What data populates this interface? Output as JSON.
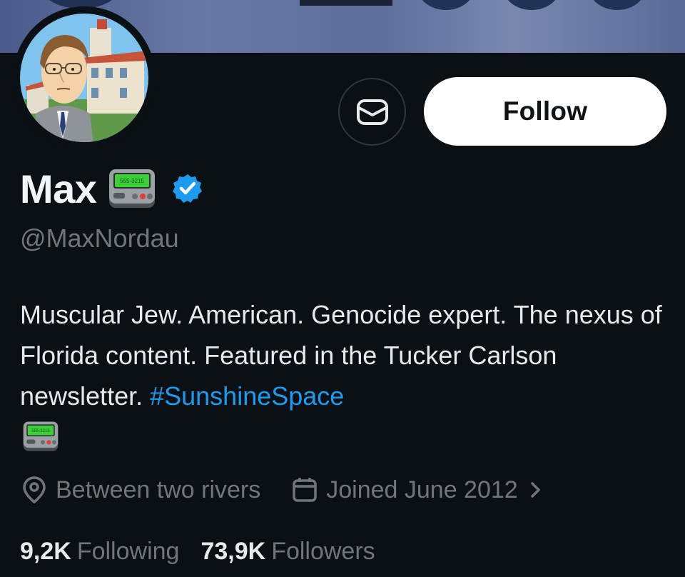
{
  "profile": {
    "display_name": "Max",
    "handle": "@MaxNordau",
    "pager_screen_text": "555-3215",
    "verified": true,
    "bio_text": "Muscular Jew. American. Genocide expert. The nexus of Florida content. Featured in the Tucker Carlson newsletter. ",
    "bio_hashtag": "#SunshineSpace",
    "location": "Between two rivers",
    "joined": "Joined June 2012",
    "following_count": "9,2K",
    "following_label": "Following",
    "followers_count": "73,9K",
    "followers_label": "Followers"
  },
  "actions": {
    "follow_label": "Follow",
    "message_icon": "envelope-icon"
  },
  "icons": {
    "location": "location-pin-icon",
    "calendar": "calendar-icon",
    "chevron": "chevron-right-icon",
    "verified": "verified-badge-icon",
    "pager": "pager-emoji-icon"
  },
  "colors": {
    "background": "#0b1014",
    "accent": "#1d9bf0",
    "muted_text": "#71767b",
    "follow_button_bg": "#ffffff"
  }
}
